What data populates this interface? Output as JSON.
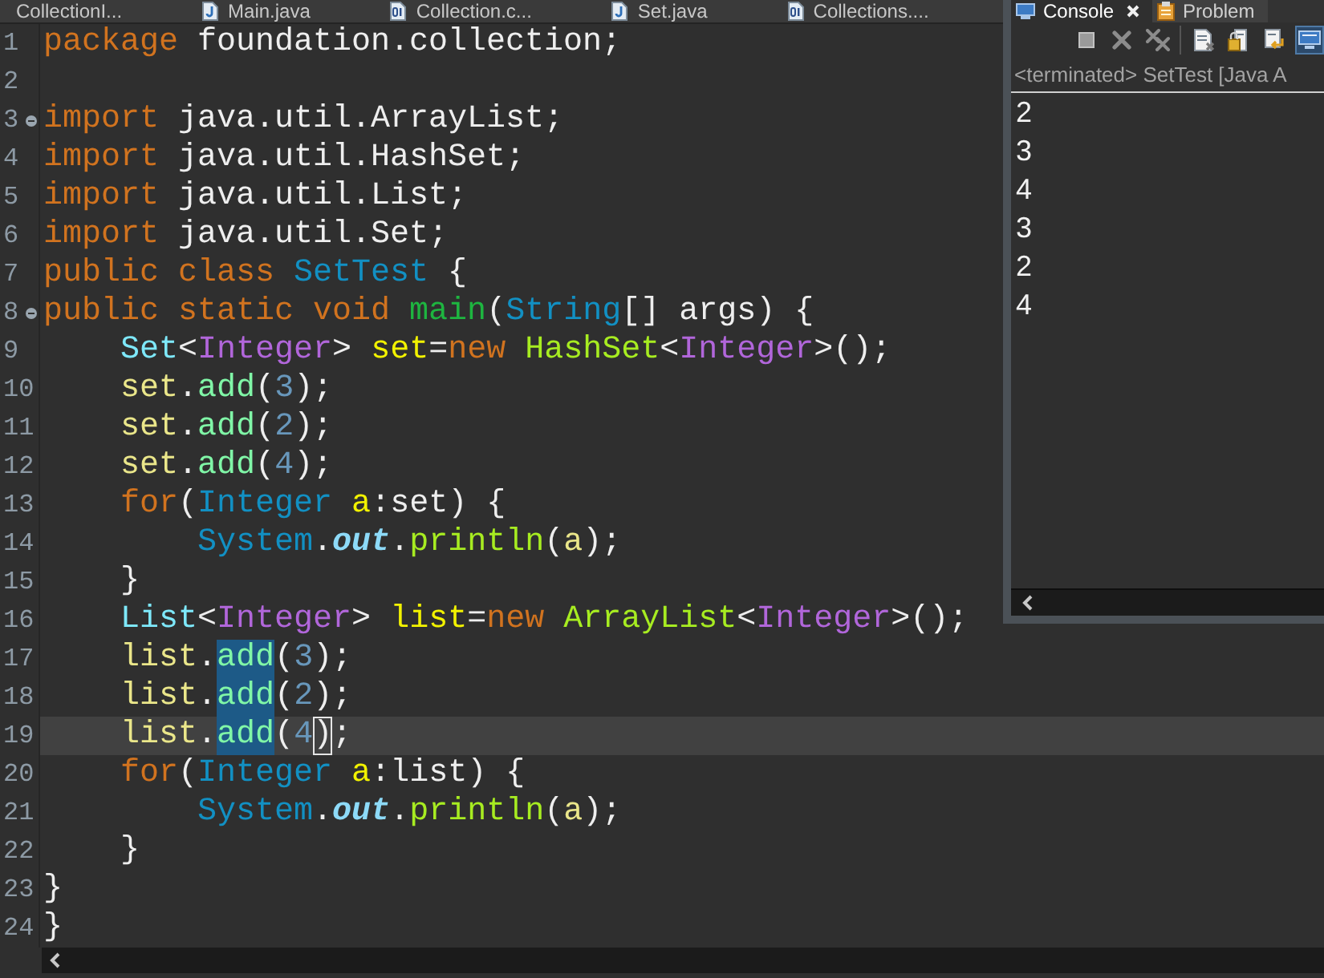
{
  "editor_tabs": [
    {
      "label": "CollectionI...",
      "selected": false
    },
    {
      "label": "Main.java",
      "selected": false,
      "kind": "java"
    },
    {
      "label": "Collection.c...",
      "selected": false,
      "kind": "class"
    },
    {
      "label": "Set.java",
      "selected": false,
      "kind": "java"
    },
    {
      "label": "Collections....",
      "selected": false,
      "kind": "class"
    }
  ],
  "editor": {
    "lines": [
      {
        "number": "1",
        "current": false,
        "segments": [
          {
            "kind": "plain",
            "tokens": [
              {
                "kind": "keyword",
                "text": "package"
              },
              {
                "kind": "plain",
                "text": " foundation.collection;"
              }
            ]
          }
        ]
      },
      {
        "number": "2",
        "current": false
      },
      {
        "number": "3",
        "current": false,
        "fold": {
          "expanded": true
        },
        "segments": [
          {
            "kind": "plain",
            "tokens": [
              {
                "kind": "keyword",
                "text": "import"
              },
              {
                "kind": "plain",
                "text": " java.util.ArrayList;"
              }
            ]
          }
        ]
      },
      {
        "number": "4",
        "current": false,
        "segments": [
          {
            "kind": "plain",
            "tokens": [
              {
                "kind": "keyword",
                "text": "import"
              },
              {
                "kind": "plain",
                "text": " java.util.HashSet;"
              }
            ]
          }
        ]
      },
      {
        "number": "5",
        "current": false,
        "segments": [
          {
            "kind": "plain",
            "tokens": [
              {
                "kind": "keyword",
                "text": "import"
              },
              {
                "kind": "plain",
                "text": " java.util.List;"
              }
            ]
          }
        ]
      },
      {
        "number": "6",
        "current": false,
        "segments": [
          {
            "kind": "plain",
            "tokens": [
              {
                "kind": "keyword",
                "text": "import"
              },
              {
                "kind": "plain",
                "text": " java.util.Set;"
              }
            ]
          }
        ]
      },
      {
        "number": "7",
        "current": false,
        "segments": [
          {
            "kind": "plain",
            "tokens": [
              {
                "kind": "keyword",
                "text": "public class"
              },
              {
                "kind": "class",
                "text": " SetTest"
              },
              {
                "kind": "plain",
                "text": " {"
              }
            ]
          }
        ]
      },
      {
        "number": "8",
        "current": false,
        "fold": {
          "expanded": true
        },
        "segments": [
          {
            "kind": "plain",
            "tokens": [
              {
                "kind": "keyword",
                "text": "public static void"
              },
              {
                "kind": "method_declaration",
                "text": " main"
              },
              {
                "kind": "plain",
                "text": "("
              },
              {
                "kind": "class",
                "text": "String"
              },
              {
                "kind": "plain",
                "text": "[] args) {"
              }
            ]
          }
        ],
        "children": [
          {
            "number": "9",
            "current": false,
            "segments": [
              {
                "kind": "plain",
                "tokens": [
                  {
                    "kind": "interface",
                    "text": "Set"
                  },
                  {
                    "kind": "plain",
                    "text": "<"
                  },
                  {
                    "kind": "type_argument",
                    "text": "Integer"
                  },
                  {
                    "kind": "plain",
                    "text": ">"
                  },
                  {
                    "kind": "local_declaration",
                    "text": " set"
                  },
                  {
                    "kind": "plain",
                    "text": "="
                  },
                  {
                    "kind": "keyword",
                    "text": "new"
                  },
                  {
                    "kind": "constructor",
                    "text": " HashSet"
                  },
                  {
                    "kind": "plain",
                    "text": "<"
                  },
                  {
                    "kind": "type_argument",
                    "text": "Integer"
                  },
                  {
                    "kind": "plain",
                    "text": ">();"
                  }
                ]
              }
            ]
          },
          {
            "number": "10",
            "current": false,
            "segments": [
              {
                "kind": "plain",
                "tokens": [
                  {
                    "kind": "local_variable",
                    "text": "set"
                  },
                  {
                    "kind": "plain",
                    "text": "."
                  },
                  {
                    "kind": "abstract_method",
                    "text": "add"
                  },
                  {
                    "kind": "plain",
                    "text": "("
                  },
                  {
                    "kind": "number",
                    "text": "3"
                  },
                  {
                    "kind": "plain",
                    "text": ");"
                  }
                ]
              }
            ]
          },
          {
            "number": "11",
            "current": false,
            "segments": [
              {
                "kind": "plain",
                "tokens": [
                  {
                    "kind": "local_variable",
                    "text": "set"
                  },
                  {
                    "kind": "plain",
                    "text": "."
                  },
                  {
                    "kind": "abstract_method",
                    "text": "add"
                  },
                  {
                    "kind": "plain",
                    "text": "("
                  },
                  {
                    "kind": "number",
                    "text": "2"
                  },
                  {
                    "kind": "plain",
                    "text": ");"
                  }
                ]
              }
            ]
          },
          {
            "number": "12",
            "current": false,
            "segments": [
              {
                "kind": "plain",
                "tokens": [
                  {
                    "kind": "local_variable",
                    "text": "set"
                  },
                  {
                    "kind": "plain",
                    "text": "."
                  },
                  {
                    "kind": "abstract_method",
                    "text": "add"
                  },
                  {
                    "kind": "plain",
                    "text": "("
                  },
                  {
                    "kind": "number",
                    "text": "4"
                  },
                  {
                    "kind": "plain",
                    "text": ");"
                  }
                ]
              }
            ]
          },
          {
            "number": "13",
            "current": false,
            "segments": [
              {
                "kind": "plain",
                "tokens": [
                  {
                    "kind": "keyword",
                    "text": "for"
                  },
                  {
                    "kind": "plain",
                    "text": "("
                  },
                  {
                    "kind": "class",
                    "text": "Integer"
                  },
                  {
                    "kind": "local_declaration",
                    "text": " a"
                  },
                  {
                    "kind": "plain",
                    "text": ":set) {"
                  }
                ]
              }
            ],
            "children": [
              {
                "number": "14",
                "current": false,
                "segments": [
                  {
                    "kind": "plain",
                    "tokens": [
                      {
                        "kind": "class",
                        "text": "System"
                      },
                      {
                        "kind": "plain",
                        "text": "."
                      },
                      {
                        "kind": "static_field",
                        "text": "out"
                      },
                      {
                        "kind": "plain",
                        "text": "."
                      },
                      {
                        "kind": "method",
                        "text": "println"
                      },
                      {
                        "kind": "plain",
                        "text": "("
                      },
                      {
                        "kind": "local_variable",
                        "text": "a"
                      },
                      {
                        "kind": "plain",
                        "text": ");"
                      }
                    ]
                  }
                ]
              }
            ]
          },
          {
            "number": "15",
            "current": false,
            "segments": [
              {
                "kind": "plain",
                "tokens": [
                  {
                    "kind": "plain",
                    "text": "}"
                  }
                ]
              }
            ]
          },
          {
            "number": "16",
            "current": false,
            "segments": [
              {
                "kind": "plain",
                "tokens": [
                  {
                    "kind": "interface",
                    "text": "List"
                  },
                  {
                    "kind": "plain",
                    "text": "<"
                  },
                  {
                    "kind": "type_argument",
                    "text": "Integer"
                  },
                  {
                    "kind": "plain",
                    "text": ">"
                  },
                  {
                    "kind": "local_declaration",
                    "text": " list"
                  },
                  {
                    "kind": "plain",
                    "text": "="
                  },
                  {
                    "kind": "keyword",
                    "text": "new"
                  },
                  {
                    "kind": "constructor",
                    "text": " ArrayList"
                  },
                  {
                    "kind": "plain",
                    "text": "<"
                  },
                  {
                    "kind": "type_argument",
                    "text": "Integer"
                  },
                  {
                    "kind": "plain",
                    "text": ">();"
                  }
                ]
              }
            ]
          },
          {
            "number": "17",
            "current": false,
            "segments": [
              {
                "kind": "plain",
                "tokens": [
                  {
                    "kind": "local_variable",
                    "text": "list"
                  },
                  {
                    "kind": "plain",
                    "text": "."
                  }
                ]
              },
              {
                "kind": "occurrence",
                "tokens": [
                  {
                    "kind": "abstract_method",
                    "text": "add"
                  }
                ]
              },
              {
                "kind": "plain",
                "tokens": [
                  {
                    "kind": "plain",
                    "text": "("
                  },
                  {
                    "kind": "number",
                    "text": "3"
                  },
                  {
                    "kind": "plain",
                    "text": ");"
                  }
                ]
              }
            ]
          },
          {
            "number": "18",
            "current": false,
            "segments": [
              {
                "kind": "plain",
                "tokens": [
                  {
                    "kind": "local_variable",
                    "text": "list"
                  },
                  {
                    "kind": "plain",
                    "text": "."
                  }
                ]
              },
              {
                "kind": "occurrence",
                "tokens": [
                  {
                    "kind": "abstract_method",
                    "text": "add"
                  }
                ]
              },
              {
                "kind": "plain",
                "tokens": [
                  {
                    "kind": "plain",
                    "text": "("
                  },
                  {
                    "kind": "number",
                    "text": "2"
                  },
                  {
                    "kind": "plain",
                    "text": ");"
                  }
                ]
              }
            ]
          },
          {
            "number": "19",
            "current": true,
            "segments": [
              {
                "kind": "plain",
                "tokens": [
                  {
                    "kind": "local_variable",
                    "text": "list"
                  },
                  {
                    "kind": "plain",
                    "text": "."
                  }
                ]
              },
              {
                "kind": "occurrence",
                "tokens": [
                  {
                    "kind": "abstract_method",
                    "text": "add"
                  }
                ]
              },
              {
                "kind": "plain",
                "tokens": [
                  {
                    "kind": "plain",
                    "text": "("
                  },
                  {
                    "kind": "number",
                    "text": "4"
                  }
                ]
              },
              {
                "kind": "bracket_match",
                "tokens": [
                  {
                    "kind": "plain",
                    "text": ")"
                  }
                ]
              },
              {
                "kind": "plain",
                "tokens": [
                  {
                    "kind": "plain",
                    "text": ";"
                  }
                ]
              }
            ]
          },
          {
            "number": "20",
            "current": false,
            "segments": [
              {
                "kind": "plain",
                "tokens": [
                  {
                    "kind": "keyword",
                    "text": "for"
                  },
                  {
                    "kind": "plain",
                    "text": "("
                  },
                  {
                    "kind": "class",
                    "text": "Integer"
                  },
                  {
                    "kind": "local_declaration",
                    "text": " a"
                  },
                  {
                    "kind": "plain",
                    "text": ":list) {"
                  }
                ]
              }
            ],
            "children": [
              {
                "number": "21",
                "current": false,
                "segments": [
                  {
                    "kind": "plain",
                    "tokens": [
                      {
                        "kind": "class",
                        "text": "System"
                      },
                      {
                        "kind": "plain",
                        "text": "."
                      },
                      {
                        "kind": "static_field",
                        "text": "out"
                      },
                      {
                        "kind": "plain",
                        "text": "."
                      },
                      {
                        "kind": "method",
                        "text": "println"
                      },
                      {
                        "kind": "plain",
                        "text": "("
                      },
                      {
                        "kind": "local_variable",
                        "text": "a"
                      },
                      {
                        "kind": "plain",
                        "text": ");"
                      }
                    ]
                  }
                ]
              }
            ]
          },
          {
            "number": "22",
            "current": false,
            "segments": [
              {
                "kind": "plain",
                "tokens": [
                  {
                    "kind": "plain",
                    "text": "}"
                  }
                ]
              }
            ]
          }
        ]
      },
      {
        "number": "23",
        "current": false,
        "segments": [
          {
            "kind": "plain",
            "tokens": [
              {
                "kind": "plain",
                "text": "}"
              }
            ]
          }
        ]
      },
      {
        "number": "24",
        "current": false,
        "segments": [
          {
            "kind": "plain",
            "tokens": [
              {
                "kind": "plain",
                "text": "}"
              }
            ]
          }
        ]
      }
    ]
  },
  "console": {
    "tabs": [
      {
        "label": "Console",
        "selected": true,
        "kind": "console",
        "closable": true
      },
      {
        "label": "Problem",
        "selected": false,
        "kind": "problems",
        "closable": false
      }
    ],
    "toolbar_buttons": [
      {
        "disabled": true,
        "pressed": false
      },
      {
        "disabled": true,
        "pressed": false
      },
      {
        "disabled": true,
        "pressed": false
      },
      {
        "disabled": false,
        "pressed": false
      },
      {
        "disabled": false,
        "pressed": false
      },
      {
        "disabled": false,
        "pressed": false
      },
      {
        "disabled": false,
        "pressed": true
      }
    ],
    "process_label": "<terminated> SetTest [Java A",
    "output": [
      "2",
      "3",
      "4",
      "3",
      "2",
      "4"
    ]
  }
}
